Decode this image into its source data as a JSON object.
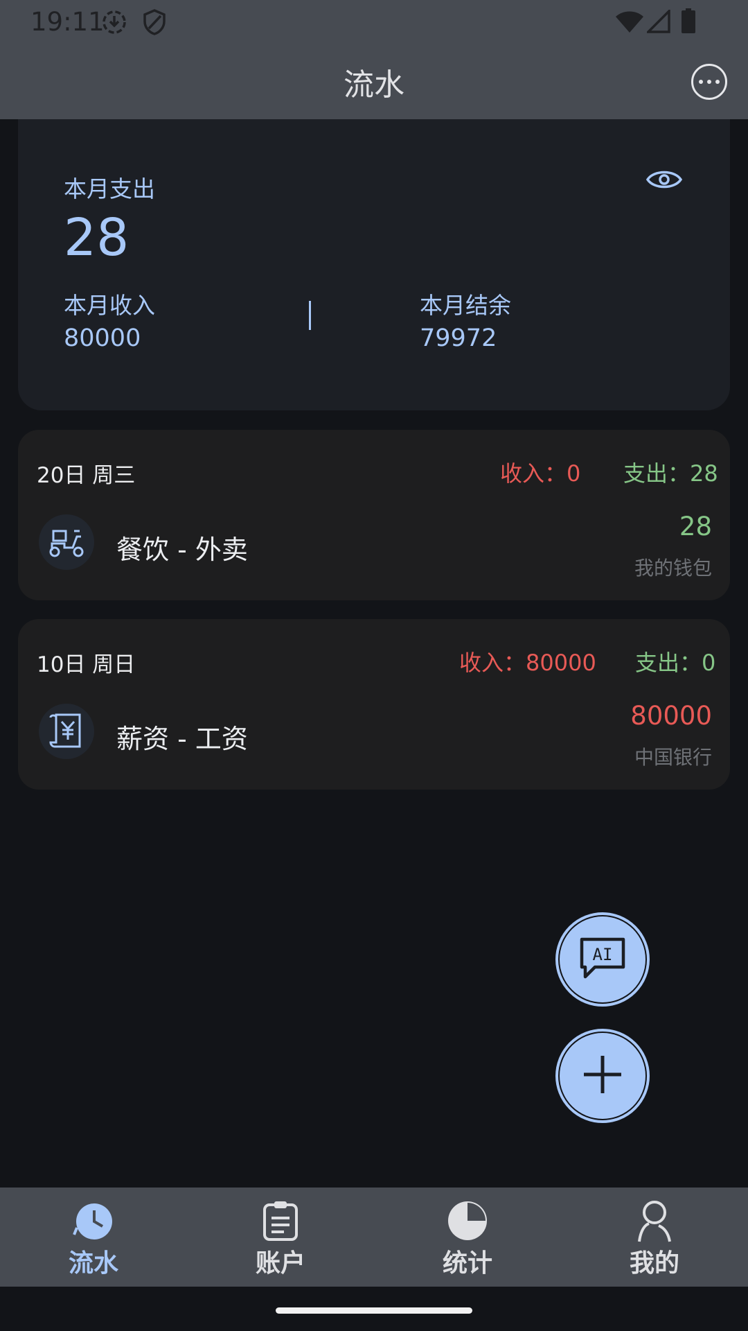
{
  "status_bar": {
    "time": "19:11"
  },
  "app_bar": {
    "title": "流水"
  },
  "summary": {
    "expense_label": "本月支出",
    "expense_value": "28",
    "income_label": "本月收入",
    "income_value": "80000",
    "balance_label": "本月结余",
    "balance_value": "79972"
  },
  "days": [
    {
      "date": "20日 周三",
      "income": "收入：0",
      "expense": "支出：28",
      "entries": [
        {
          "title": "餐饮 - 外卖",
          "amount": "28",
          "account": "我的钱包",
          "icon": "scooter-icon",
          "amount_color": "#86c687"
        }
      ]
    },
    {
      "date": "10日 周日",
      "income": "收入：80000",
      "expense": "支出：0",
      "entries": [
        {
          "title": "薪资 - 工资",
          "amount": "80000",
          "account": "中国银行",
          "icon": "yuan-receipt-icon",
          "amount_color": "#e85a56"
        }
      ]
    }
  ],
  "fab": {
    "ai_icon": "ai-chat-icon",
    "add_icon": "plus-icon"
  },
  "bottom_nav": [
    {
      "label": "流水",
      "icon": "clock-icon",
      "active": true
    },
    {
      "label": "账户",
      "icon": "clipboard-icon",
      "active": false
    },
    {
      "label": "统计",
      "icon": "pie-chart-icon",
      "active": false
    },
    {
      "label": "我的",
      "icon": "person-icon",
      "active": false
    }
  ],
  "colors": {
    "accent": "#a8c8f8",
    "income": "#e85a56",
    "expense": "#86c687"
  }
}
